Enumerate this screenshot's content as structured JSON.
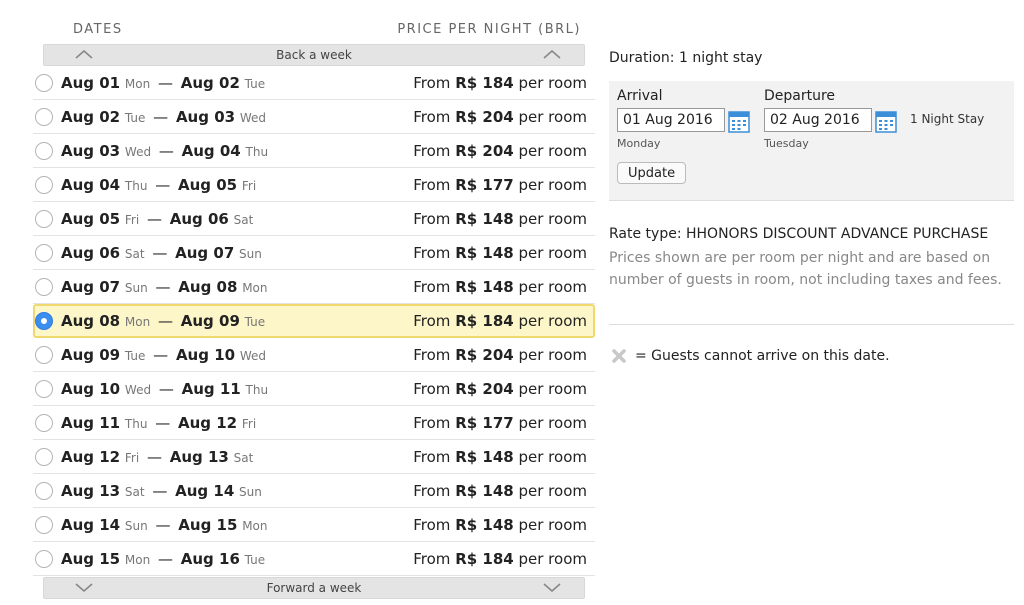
{
  "headers": {
    "dates": "DATES",
    "price": "PRICE PER NIGHT (BRL)"
  },
  "nav": {
    "back": "Back a week",
    "forward": "Forward a week"
  },
  "rows": [
    {
      "d1": "Aug 01",
      "w1": "Mon",
      "d2": "Aug 02",
      "w2": "Tue",
      "from": "From",
      "price": "R$ 184",
      "unit": "per room",
      "selected": false
    },
    {
      "d1": "Aug 02",
      "w1": "Tue",
      "d2": "Aug 03",
      "w2": "Wed",
      "from": "From",
      "price": "R$ 204",
      "unit": "per room",
      "selected": false
    },
    {
      "d1": "Aug 03",
      "w1": "Wed",
      "d2": "Aug 04",
      "w2": "Thu",
      "from": "From",
      "price": "R$ 204",
      "unit": "per room",
      "selected": false
    },
    {
      "d1": "Aug 04",
      "w1": "Thu",
      "d2": "Aug 05",
      "w2": "Fri",
      "from": "From",
      "price": "R$ 177",
      "unit": "per room",
      "selected": false
    },
    {
      "d1": "Aug 05",
      "w1": "Fri",
      "d2": "Aug 06",
      "w2": "Sat",
      "from": "From",
      "price": "R$ 148",
      "unit": "per room",
      "selected": false
    },
    {
      "d1": "Aug 06",
      "w1": "Sat",
      "d2": "Aug 07",
      "w2": "Sun",
      "from": "From",
      "price": "R$ 148",
      "unit": "per room",
      "selected": false
    },
    {
      "d1": "Aug 07",
      "w1": "Sun",
      "d2": "Aug 08",
      "w2": "Mon",
      "from": "From",
      "price": "R$ 148",
      "unit": "per room",
      "selected": false
    },
    {
      "d1": "Aug 08",
      "w1": "Mon",
      "d2": "Aug 09",
      "w2": "Tue",
      "from": "From",
      "price": "R$ 184",
      "unit": "per room",
      "selected": true
    },
    {
      "d1": "Aug 09",
      "w1": "Tue",
      "d2": "Aug 10",
      "w2": "Wed",
      "from": "From",
      "price": "R$ 204",
      "unit": "per room",
      "selected": false
    },
    {
      "d1": "Aug 10",
      "w1": "Wed",
      "d2": "Aug 11",
      "w2": "Thu",
      "from": "From",
      "price": "R$ 204",
      "unit": "per room",
      "selected": false
    },
    {
      "d1": "Aug 11",
      "w1": "Thu",
      "d2": "Aug 12",
      "w2": "Fri",
      "from": "From",
      "price": "R$ 177",
      "unit": "per room",
      "selected": false
    },
    {
      "d1": "Aug 12",
      "w1": "Fri",
      "d2": "Aug 13",
      "w2": "Sat",
      "from": "From",
      "price": "R$ 148",
      "unit": "per room",
      "selected": false
    },
    {
      "d1": "Aug 13",
      "w1": "Sat",
      "d2": "Aug 14",
      "w2": "Sun",
      "from": "From",
      "price": "R$ 148",
      "unit": "per room",
      "selected": false
    },
    {
      "d1": "Aug 14",
      "w1": "Sun",
      "d2": "Aug 15",
      "w2": "Mon",
      "from": "From",
      "price": "R$ 148",
      "unit": "per room",
      "selected": false
    },
    {
      "d1": "Aug 15",
      "w1": "Mon",
      "d2": "Aug 16",
      "w2": "Tue",
      "from": "From",
      "price": "R$ 184",
      "unit": "per room",
      "selected": false
    }
  ],
  "stay": {
    "duration": "Duration: 1 night stay",
    "arrival_label": "Arrival",
    "departure_label": "Departure",
    "arrival_value": "01 Aug 2016",
    "departure_value": "02 Aug 2016",
    "arrival_day": "Monday",
    "departure_day": "Tuesday",
    "nights": "1 Night Stay",
    "update_label": "Update"
  },
  "rate": {
    "type": "Rate type: HHONORS DISCOUNT ADVANCE PURCHASE",
    "description": "Prices shown are per room per night and are based on number of guests in room, not including taxes and fees."
  },
  "legend": {
    "text": "= Guests cannot arrive on this date."
  },
  "colors": {
    "selected_bg": "#fdf6c8",
    "selected_border": "#f0d870",
    "radio_selected": "#3b8df0",
    "calendar_blue": "#3a8fd8"
  }
}
